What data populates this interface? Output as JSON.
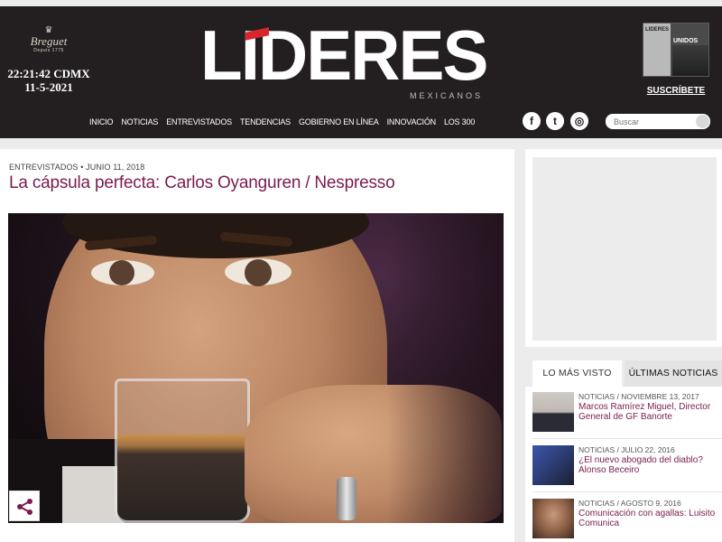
{
  "header": {
    "brand": {
      "crown": "♛",
      "name": "Breguet",
      "sub": "Depuis 1775"
    },
    "clock": {
      "time": "22:21:42 CDMX",
      "date": "11-5-2021"
    },
    "logo": {
      "text": "LIDERES",
      "sub": "MEXICANOS"
    },
    "magazine": {
      "cover_title": "LIDERES",
      "cover_title2": "UNIDOS",
      "subscribe_label": "SUSCRÍBETE"
    },
    "nav": [
      "INICIO",
      "NOTICIAS",
      "ENTREVISTADOS",
      "TENDENCIAS",
      "GOBIERNO EN LÍNEA",
      "INNOVACIÓN",
      "LOS 300"
    ],
    "social": {
      "facebook": "f",
      "twitter": "t",
      "instagram": "◎"
    },
    "search": {
      "placeholder": "Buscar"
    }
  },
  "article": {
    "category": "ENTREVISTADOS",
    "date": "JUNIO 11, 2018",
    "title": "La cápsula perfecta: Carlos Oyanguren / Nespresso",
    "share_icon": "share-icon"
  },
  "sidebar": {
    "tabs": [
      "LO MÁS VISTO",
      "ÚLTIMAS NOTICIAS"
    ],
    "items": [
      {
        "meta": "NOTICIAS / NOVIEMBRE 13, 2017",
        "title": "Marcos Ramírez Miguel, Director General de GF Banorte"
      },
      {
        "meta": "NOTICIAS / JULIO 22, 2016",
        "title": "¿El nuevo abogado del diablo? Alonso Beceiro"
      },
      {
        "meta": "NOTICIAS / AGOSTO 9, 2016",
        "title": "Comunicación con agallas: Luisito Comunica"
      }
    ]
  },
  "colors": {
    "header_bg": "#231f20",
    "accent": "#7b1b4e",
    "logo_red": "#d8262e"
  }
}
